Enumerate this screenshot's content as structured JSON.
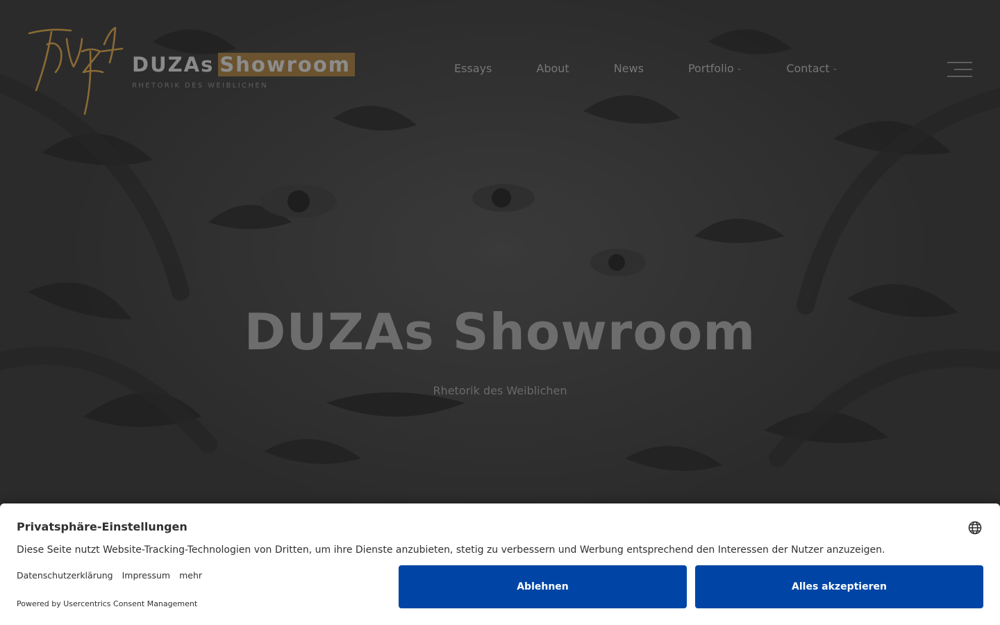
{
  "header": {
    "brand_name": "DUZAs",
    "brand_highlight": "Showroom",
    "tagline": "Rhetorik des Weiblichen"
  },
  "nav": {
    "items": [
      {
        "label": "Essays"
      },
      {
        "label": "About"
      },
      {
        "label": "News"
      },
      {
        "label": "Portfolio",
        "dropdown": true
      },
      {
        "label": "Contact",
        "dropdown": true
      }
    ]
  },
  "hero": {
    "title": "DUZAs Showroom",
    "subtitle": "Rhetorik des Weiblichen"
  },
  "consent": {
    "title": "Privatsphäre-Einstellungen",
    "text": "Diese Seite nutzt Website-Tracking-Technologien von Dritten, um ihre Dienste anzubieten, stetig zu verbessern und Werbung entsprechend den Interessen der Nutzer anzuzeigen.",
    "links": [
      "Datenschutzerklärung",
      "Impressum",
      "mehr"
    ],
    "powered_by": "Powered by Usercentrics Consent Management",
    "deny_label": "Ablehnen",
    "accept_label": "Alles akzeptieren"
  },
  "colors": {
    "accent_gold": "#6b5330",
    "logo_gold": "#8a6a35",
    "button_blue": "#0045a5"
  },
  "icons": [
    "duza-logo",
    "chevron-down-icon",
    "hamburger-menu-icon",
    "globe-icon"
  ]
}
